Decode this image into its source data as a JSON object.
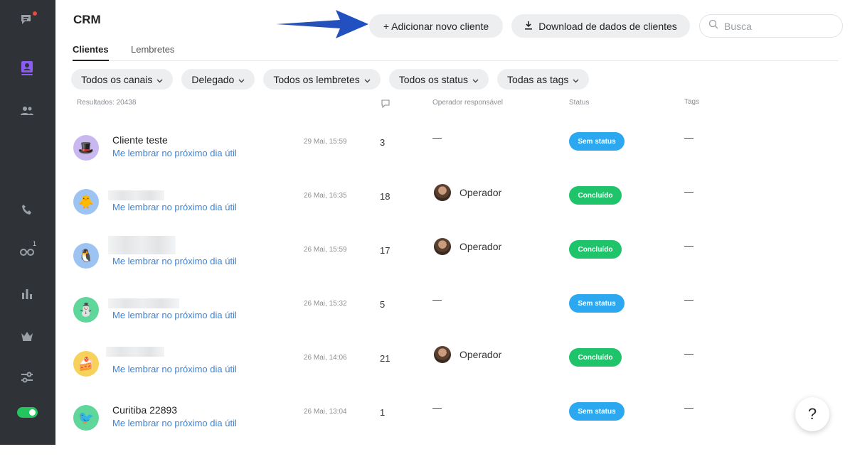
{
  "app": {
    "title": "CRM",
    "accent": "#8b5cf6",
    "link_color": "#3b82d6"
  },
  "sidebar": {
    "items": [
      {
        "icon": "chat-icon",
        "has_dot": true
      },
      {
        "icon": "crm-contact-icon",
        "active": true
      },
      {
        "icon": "team-icon"
      },
      {
        "icon": "phone-icon"
      },
      {
        "icon": "binoculars-icon",
        "count": "1"
      },
      {
        "icon": "bar-chart-icon"
      },
      {
        "icon": "crown-icon"
      },
      {
        "icon": "sliders-icon"
      }
    ],
    "toggle_on": true
  },
  "toolbar": {
    "add_label": "+ Adicionar novo cliente",
    "download_label": "Download de dados de clientes",
    "search_placeholder": "Busca"
  },
  "tabs": [
    "Clientes",
    "Lembretes"
  ],
  "filters": [
    "Todos os canais",
    "Delegado",
    "Todos os lembretes",
    "Todos os status",
    "Todas as tags"
  ],
  "table": {
    "results": "Resultados: 20438",
    "headers": {
      "operator": "Operador responsável",
      "status": "Status",
      "tags": "Tags"
    },
    "rows": [
      {
        "name": "Cliente teste",
        "avatar": "🎩",
        "avatar_bg": "#c9b8f0",
        "reminder": "Me lembrar no próximo dia útil",
        "date": "29 Mai, 15:59",
        "messages": "3",
        "operator": "",
        "status": "Sem status",
        "tags": "—"
      },
      {
        "name": "",
        "avatar": "🐥",
        "avatar_bg": "#9cc3f2",
        "reminder": "Me lembrar no próximo dia útil",
        "date": "26 Mai, 16:35",
        "messages": "18",
        "operator": "Operador",
        "status": "Concluído",
        "tags": "—"
      },
      {
        "name": "",
        "avatar": "🐧",
        "avatar_bg": "#9cc3f2",
        "reminder": "Me lembrar no próximo dia útil",
        "date": "26 Mai, 15:59",
        "messages": "17",
        "operator": "Operador",
        "status": "Concluído",
        "tags": "—"
      },
      {
        "name": "",
        "avatar": "⛄",
        "avatar_bg": "#5fd69a",
        "reminder": "Me lembrar no próximo dia útil",
        "date": "26 Mai, 15:32",
        "messages": "5",
        "operator": "",
        "status": "Sem status",
        "tags": "—"
      },
      {
        "name": "",
        "avatar": "🍰",
        "avatar_bg": "#f7d25a",
        "reminder": "Me lembrar no próximo dia útil",
        "date": "26 Mai, 14:06",
        "messages": "21",
        "operator": "Operador",
        "status": "Concluído",
        "tags": "—"
      },
      {
        "name": "Curitiba 22893",
        "avatar": "🐦",
        "avatar_bg": "#5fd69a",
        "reminder": "Me lembrar no próximo dia útil",
        "date": "26 Mai, 13:04",
        "messages": "1",
        "operator": "",
        "status": "Sem status",
        "tags": "—"
      }
    ]
  },
  "dash": "—",
  "help_label": "?"
}
